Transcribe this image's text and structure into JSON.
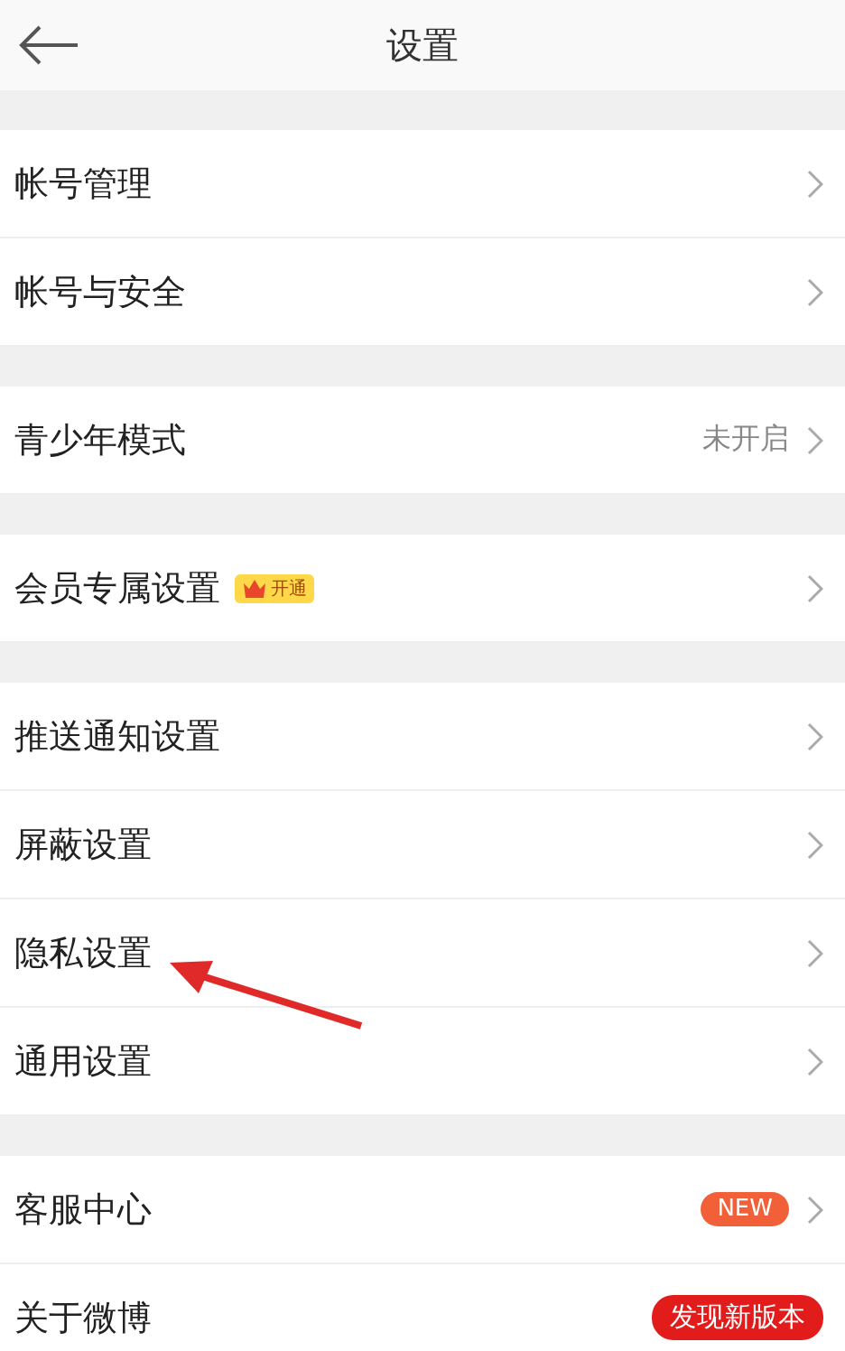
{
  "header": {
    "title": "设置"
  },
  "groups": [
    {
      "rows": [
        {
          "label": "帐号管理"
        },
        {
          "label": "帐号与安全"
        }
      ]
    },
    {
      "rows": [
        {
          "label": "青少年模式",
          "value": "未开启"
        }
      ]
    },
    {
      "rows": [
        {
          "label": "会员专属设置",
          "badge": {
            "kind": "vip",
            "text": "开通"
          }
        }
      ]
    },
    {
      "rows": [
        {
          "label": "推送通知设置"
        },
        {
          "label": "屏蔽设置"
        },
        {
          "label": "隐私设置"
        },
        {
          "label": "通用设置"
        }
      ]
    },
    {
      "rows": [
        {
          "label": "客服中心",
          "badge": {
            "kind": "new",
            "text": "NEW"
          }
        },
        {
          "label": "关于微博",
          "badge": {
            "kind": "update",
            "text": "发现新版本"
          }
        }
      ]
    }
  ]
}
